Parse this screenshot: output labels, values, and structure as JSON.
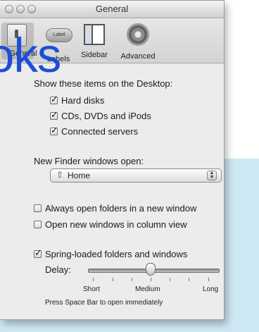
{
  "window": {
    "title": "General"
  },
  "toolbar": {
    "items": [
      {
        "label": "General",
        "icon": "switch-icon"
      },
      {
        "label": "Labels",
        "icon": "label-icon",
        "icon_text": "Label"
      },
      {
        "label": "Sidebar",
        "icon": "sidebar-icon"
      },
      {
        "label": "Advanced",
        "icon": "gear-icon"
      }
    ]
  },
  "desktop_section": {
    "heading": "Show these items on the Desktop:",
    "items": [
      {
        "label": "Hard disks",
        "checked": true
      },
      {
        "label": "CDs, DVDs and iPods",
        "checked": true
      },
      {
        "label": "Connected servers",
        "checked": true
      }
    ]
  },
  "finder_windows": {
    "heading": "New Finder windows open:",
    "popup_value": "Home",
    "popup_icon": "home-icon"
  },
  "options": [
    {
      "label": "Always open folders in a new window",
      "checked": false
    },
    {
      "label": "Open new windows in column view",
      "checked": false
    },
    {
      "label": "Spring-loaded folders and windows",
      "checked": true
    }
  ],
  "delay": {
    "label": "Delay:",
    "ticks": [
      "Short",
      "Medium",
      "Long"
    ],
    "value": 0.5,
    "hint": "Press Space Bar to open immediately"
  },
  "overlay_text": "oks",
  "colors": {
    "overlay": "#1a4fd6",
    "backdrop": "#cfe9f4"
  }
}
